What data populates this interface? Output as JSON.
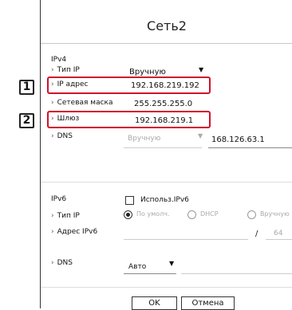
{
  "dialog": {
    "title": "Сеть2"
  },
  "ipv4": {
    "section": "IPv4",
    "type_label": "Тип IP",
    "type_value": "Вручную",
    "ip_label": "IP адрес",
    "ip_value": "192.168.219.192",
    "mask_label": "Сетевая маска",
    "mask_value": "255.255.255.0",
    "gw_label": "Шлюз",
    "gw_value": "192.168.219.1",
    "dns_label": "DNS",
    "dns_mode": "Вручную",
    "dns_value": "168.126.63.1"
  },
  "ipv6": {
    "section": "IPv6",
    "use_label": "Использ.IPv6",
    "use_checked": false,
    "type_label": "Тип IP",
    "type_options": [
      "По умолч.",
      "DHCP",
      "Вручную"
    ],
    "type_selected": "По умолч.",
    "addr_label": "Адрес IPv6",
    "prefix_sep": "/",
    "prefix_value": "64",
    "dns_label": "DNS",
    "dns_value": "Авто"
  },
  "callouts": [
    "1",
    "2"
  ],
  "buttons": {
    "ok": "OK",
    "cancel": "Отмена"
  },
  "icons": {
    "dropdown": "triangle-down-icon"
  },
  "colors": {
    "highlight": "#d1112c",
    "border": "#333333",
    "disabled": "#aaaaaa"
  }
}
